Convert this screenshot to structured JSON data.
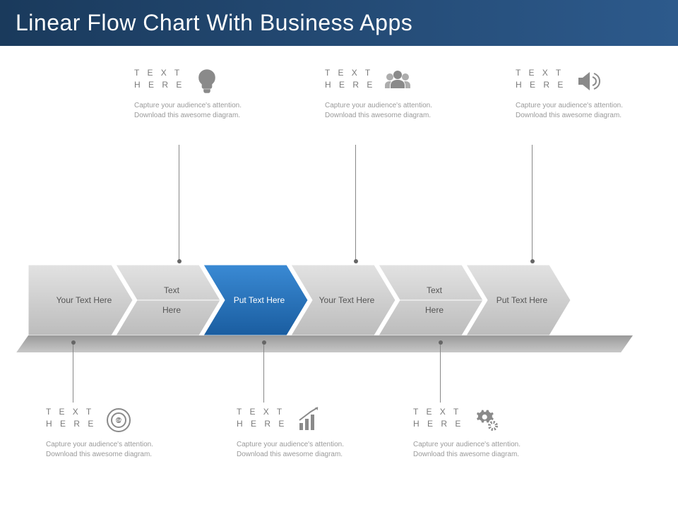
{
  "title": "Linear Flow Chart With Business Apps",
  "callout_label_line1": "T E X T",
  "callout_label_line2": "H E R E",
  "callout_desc": "Capture your audience's attention. Download this awesome diagram.",
  "top_callouts": [
    {
      "icon": "bulb"
    },
    {
      "icon": "people"
    },
    {
      "icon": "speaker"
    }
  ],
  "bottom_callouts": [
    {
      "icon": "goal"
    },
    {
      "icon": "chart"
    },
    {
      "icon": "gear"
    }
  ],
  "chevrons": [
    {
      "line1": "Your Text Here",
      "line2": "",
      "highlight": false
    },
    {
      "line1": "Text",
      "line2": "Here",
      "highlight": false
    },
    {
      "line1": "Put Text Here",
      "line2": "",
      "highlight": true
    },
    {
      "line1": "Your Text Here",
      "line2": "",
      "highlight": false
    },
    {
      "line1": "Text",
      "line2": "Here",
      "highlight": false
    },
    {
      "line1": "Put Text Here",
      "line2": "",
      "highlight": false
    }
  ],
  "colors": {
    "highlight": "#1f6fc0",
    "chevron_light": "#d6d6d6",
    "chevron_dark": "#b8b8b8"
  }
}
